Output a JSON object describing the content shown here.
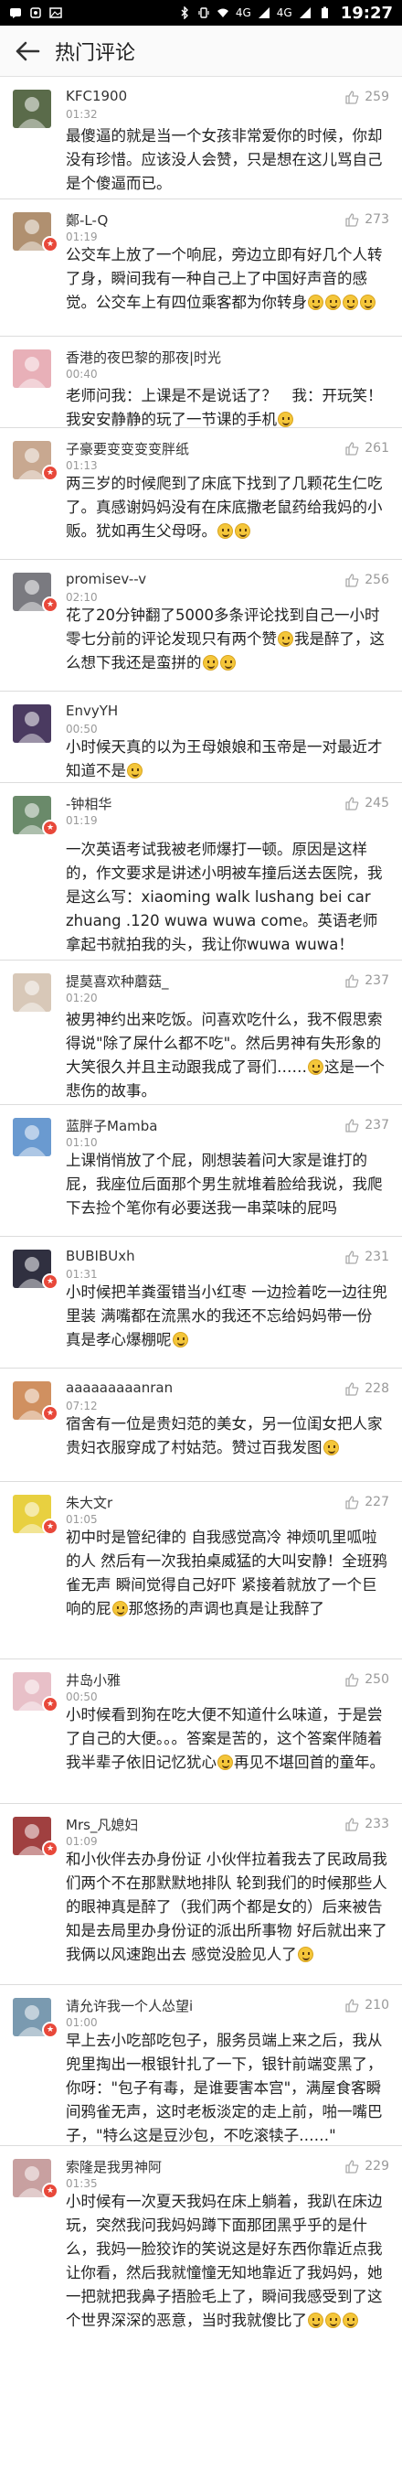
{
  "status_bar": {
    "time": "19:27",
    "signal_labels": [
      "4G",
      "4G"
    ]
  },
  "header": {
    "title": "热门评论"
  },
  "comments": [
    {
      "name": "KFC1900",
      "time": "01:32",
      "likes": "259",
      "text": "最傻逼的就是当一个女孩非常爱你的时候，你却没有珍惜。应该没人会赞，只是想在这儿骂自己是个傻逼而已。"
    },
    {
      "name": "鄭-L-Q",
      "time": "01:19",
      "likes": "273",
      "text": "公交车上放了一个响屁，旁边立即有好几个人转了身，瞬间我有一种自己上了中国好声音的感觉。公交车上有四位乘客都为你转身",
      "emojis": 4
    },
    {
      "name": "香港的夜巴黎的那夜|时光",
      "time": "00:40",
      "likes": "",
      "text": "老师问我：上课是不是说话了？　我：开玩笑！我安安静静的玩了一节课的手机",
      "emojis": 1
    },
    {
      "name": "子豪要变变变变胖纸",
      "time": "01:13",
      "likes": "261",
      "text": "两三岁的时候爬到了床底下找到了几颗花生仁吃了。真感谢妈妈没有在床底撒老鼠药给我妈的小贩。犹如再生父母呀。",
      "emojis": 2
    },
    {
      "name": "promisev--v",
      "time": "02:10",
      "likes": "256",
      "text": "花了20分钟翻了5000多条评论找到自己一小时零七分前的评论发现只有两个赞",
      "tail": "我是醉了，这么想下我还是蛮拼的",
      "emojis": 3
    },
    {
      "name": "EnvyYH",
      "time": "00:50",
      "likes": "",
      "text": "小时候天真的以为王母娘娘和玉帝是一对最近才知道不是",
      "emojis": 1
    },
    {
      "name": "-钟相华",
      "time": "01:19",
      "likes": "245",
      "text": "一次英语考试我被老师爆打一顿。原因是这样的，作文要求是讲述小明被车撞后送去医院，我是这么写：xiaoming walk lushang bei car zhuang .120 wuwa wuwa come。英语老师拿起书就拍我的头，我让你wuwa wuwa！"
    },
    {
      "name": "提莫喜欢种蘑菇_",
      "time": "01:20",
      "likes": "237",
      "text": "被男神约出来吃饭。问喜欢吃什么，我不假思索得说\"除了屎什么都不吃\"。然后男神有失形象的大笑很久并且主动跟我成了哥们……",
      "tail": "这是一个悲伤的故事。",
      "emojis": 1
    },
    {
      "name": "蓝胖子Mamba",
      "time": "01:10",
      "likes": "237",
      "text": "上课悄悄放了个屁，刚想装着问大家是谁打的屁，我座位后面那个男生就堆着脸给我说，我爬下去捡个笔你有必要送我一串菜味的屁吗"
    },
    {
      "name": "BUBIBUxh",
      "time": "01:31",
      "likes": "231",
      "text": "小时候把羊粪蛋错当小红枣 一边捡着吃一边往兜里装 满嘴都在流黑水的我还不忘给妈妈带一份 真是孝心爆棚呢",
      "emojis": 1
    },
    {
      "name": "aaaaaaaaanran",
      "time": "07:12",
      "likes": "228",
      "text": "宿舍有一位是贵妇范的美女，另一位闺女把人家贵妇衣服穿成了村姑范。赞过百我发图",
      "emojis": 1
    },
    {
      "name": "朱大文r",
      "time": "01:05",
      "likes": "227",
      "text": "初中时是管纪律的 自我感觉高冷 神烦叽里呱啦的人 然后有一次我拍桌威猛的大叫安静！全班鸦雀无声 瞬间觉得自己好吓 紧接着就放了一个巨响的屁",
      "tail": "那悠扬的声调也真是让我醉了",
      "emojis": 1
    },
    {
      "name": "井岛小雅",
      "time": "00:50",
      "likes": "250",
      "text": "小时候看到狗在吃大便不知道什么味道，于是尝了自己的大便。。。答案是苦的，这个答案伴随着我半辈子依旧记忆犹心",
      "tail": "再见不堪回首的童年。",
      "emojis": 1
    },
    {
      "name": "Mrs_凡媳妇",
      "time": "01:09",
      "likes": "233",
      "text": "和小伙伴去办身份证 小伙伴拉着我去了民政局我们两个不在那默默地排队 轮到我们的时候那些人的眼神真是醉了（我们两个都是女的）后来被告知是去局里办身份证的派出所事物 好后就出来了 我俩以风速跑出去 感觉没脸见人了",
      "emojis": 1
    },
    {
      "name": "请允许我一个人怂望i",
      "time": "01:00",
      "likes": "210",
      "text": "早上去小吃部吃包子，服务员端上来之后，我从兜里掏出一根银针扎了一下，银针前端变黑了，你呀：\"包子有毒，是谁要害本宫\"，满屋食客瞬间鸦雀无声，这时老板淡定的走上前，啪一嘴巴子，\"特么这是豆沙包，不吃滚犊子……\""
    },
    {
      "name": "索隆是我男神阿",
      "time": "01:35",
      "likes": "229",
      "text": "小时候有一次夏天我妈在床上躺着，我趴在床边玩，突然我问我妈妈蹲下面那团黑乎乎的是什么，我妈一脸狡诈的笑说这是好东西你靠近点我让你看，然后我就憧憧无知地靠近了我妈妈，她一把就把我鼻子捂脸毛上了，瞬间我感受到了这个世界深深的恶意，当时我就傻比了",
      "emojis": 3
    }
  ],
  "colors": {
    "badge": "#e8483a",
    "meta": "#999999",
    "text": "#222222",
    "divider": "#dcdcdc",
    "appbar_bg": "#fafafa"
  }
}
